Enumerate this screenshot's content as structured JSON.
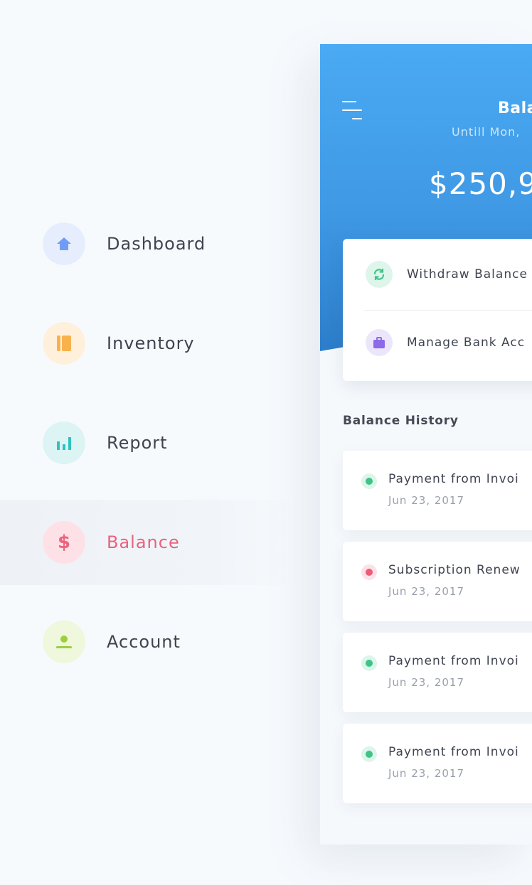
{
  "nav": {
    "items": [
      {
        "label": "Dashboard",
        "icon": "home-icon",
        "color": "#6f9cf7",
        "bg": "#e6eefe"
      },
      {
        "label": "Inventory",
        "icon": "book-icon",
        "color": "#f7b24d",
        "bg": "#fff0dc"
      },
      {
        "label": "Report",
        "icon": "bar-chart-icon",
        "color": "#2fc2bf",
        "bg": "#dcf4f3"
      },
      {
        "label": "Balance",
        "icon": "dollar-icon",
        "color": "#ec6480",
        "bg": "#fde1e6",
        "active": true
      },
      {
        "label": "Account",
        "icon": "user-icon",
        "color": "#9ccf3e",
        "bg": "#eff7dc"
      }
    ]
  },
  "header": {
    "title": "Bala",
    "subtitle": "Untill Mon,",
    "amount": "$250,9"
  },
  "actions": [
    {
      "label": "Withdraw Balance",
      "icon": "refresh-icon",
      "color": "#3dc486",
      "bg": "#ddf5ea"
    },
    {
      "label": "Manage Bank Acc",
      "icon": "briefcase-icon",
      "color": "#8d6ae8",
      "bg": "#ece6fb"
    }
  ],
  "history": {
    "title": "Balance History",
    "items": [
      {
        "title": "Payment from Invoi",
        "date": "Jun 23, 2017",
        "status": "success"
      },
      {
        "title": "Subscription Renew",
        "date": "Jun 23, 2017",
        "status": "danger"
      },
      {
        "title": "Payment from Invoi",
        "date": "Jun 23, 2017",
        "status": "success"
      },
      {
        "title": "Payment from Invoi",
        "date": "Jun 23, 2017",
        "status": "success"
      }
    ]
  }
}
